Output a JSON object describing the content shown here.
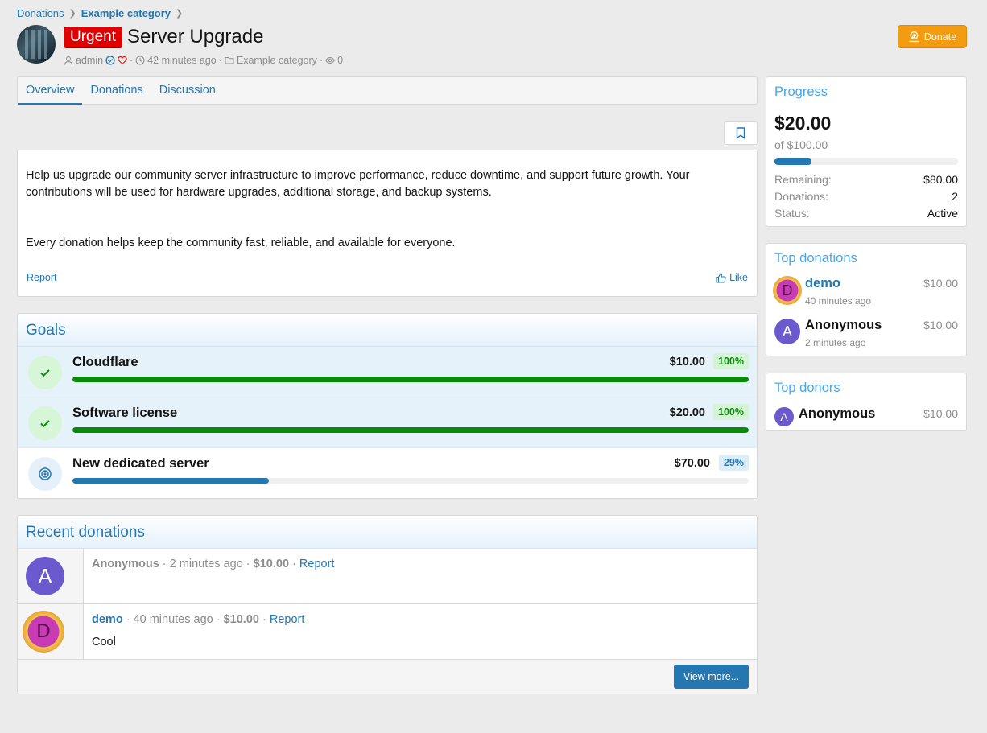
{
  "breadcrumb": [
    "Donations",
    "Example category"
  ],
  "header": {
    "badge": "Urgent",
    "title": "Server Upgrade",
    "author": "admin",
    "time": "42 minutes ago",
    "category": "Example category",
    "views": "0",
    "donate_label": "Donate"
  },
  "tabs": [
    "Overview",
    "Donations",
    "Discussion"
  ],
  "post": {
    "paragraph1": "Help us upgrade our community server infrastructure to improve performance, reduce downtime, and support future growth. Your contributions will be used for hardware upgrades, additional storage, and backup systems.",
    "paragraph2": "Every donation helps keep the community fast, reliable, and available for everyone.",
    "report": "Report",
    "like": "Like"
  },
  "goals": {
    "title": "Goals",
    "items": [
      {
        "name": "Cloudflare",
        "amount": "$10.00",
        "percent": "100%",
        "progress": 1.0,
        "status": "complete"
      },
      {
        "name": "Software license",
        "amount": "$20.00",
        "percent": "100%",
        "progress": 1.0,
        "status": "complete"
      },
      {
        "name": "New dedicated server",
        "amount": "$70.00",
        "percent": "29%",
        "progress": 0.29,
        "status": "in-progress"
      }
    ]
  },
  "recent": {
    "title": "Recent donations",
    "items": [
      {
        "name": "Anonymous",
        "time": "2 minutes ago",
        "amount": "$10.00",
        "report": "Report",
        "message": "",
        "avatar": "A"
      },
      {
        "name": "demo",
        "time": "40 minutes ago",
        "amount": "$10.00",
        "report": "Report",
        "message": "Cool",
        "avatar": "D"
      }
    ],
    "view_more": "View more..."
  },
  "progress": {
    "title": "Progress",
    "raised": "$20.00",
    "of": "of $100.00",
    "fraction": 0.2,
    "remaining_label": "Remaining:",
    "remaining": "$80.00",
    "donations_label": "Donations:",
    "donations": "2",
    "status_label": "Status:",
    "status": "Active"
  },
  "top_donations": {
    "title": "Top donations",
    "items": [
      {
        "name": "demo",
        "time": "40 minutes ago",
        "amount": "$10.00",
        "avatar": "D"
      },
      {
        "name": "Anonymous",
        "time": "2 minutes ago",
        "amount": "$10.00",
        "avatar": "A"
      }
    ]
  },
  "top_donors": {
    "title": "Top donors",
    "items": [
      {
        "name": "Anonymous",
        "amount": "$10.00",
        "avatar": "A"
      }
    ]
  },
  "colors": {
    "accent": "#2577b1",
    "urgent": "#e00000",
    "donate": "#f39c12",
    "goal_complete": "#0a8a0a",
    "avatar_a": "#6a5acd"
  }
}
